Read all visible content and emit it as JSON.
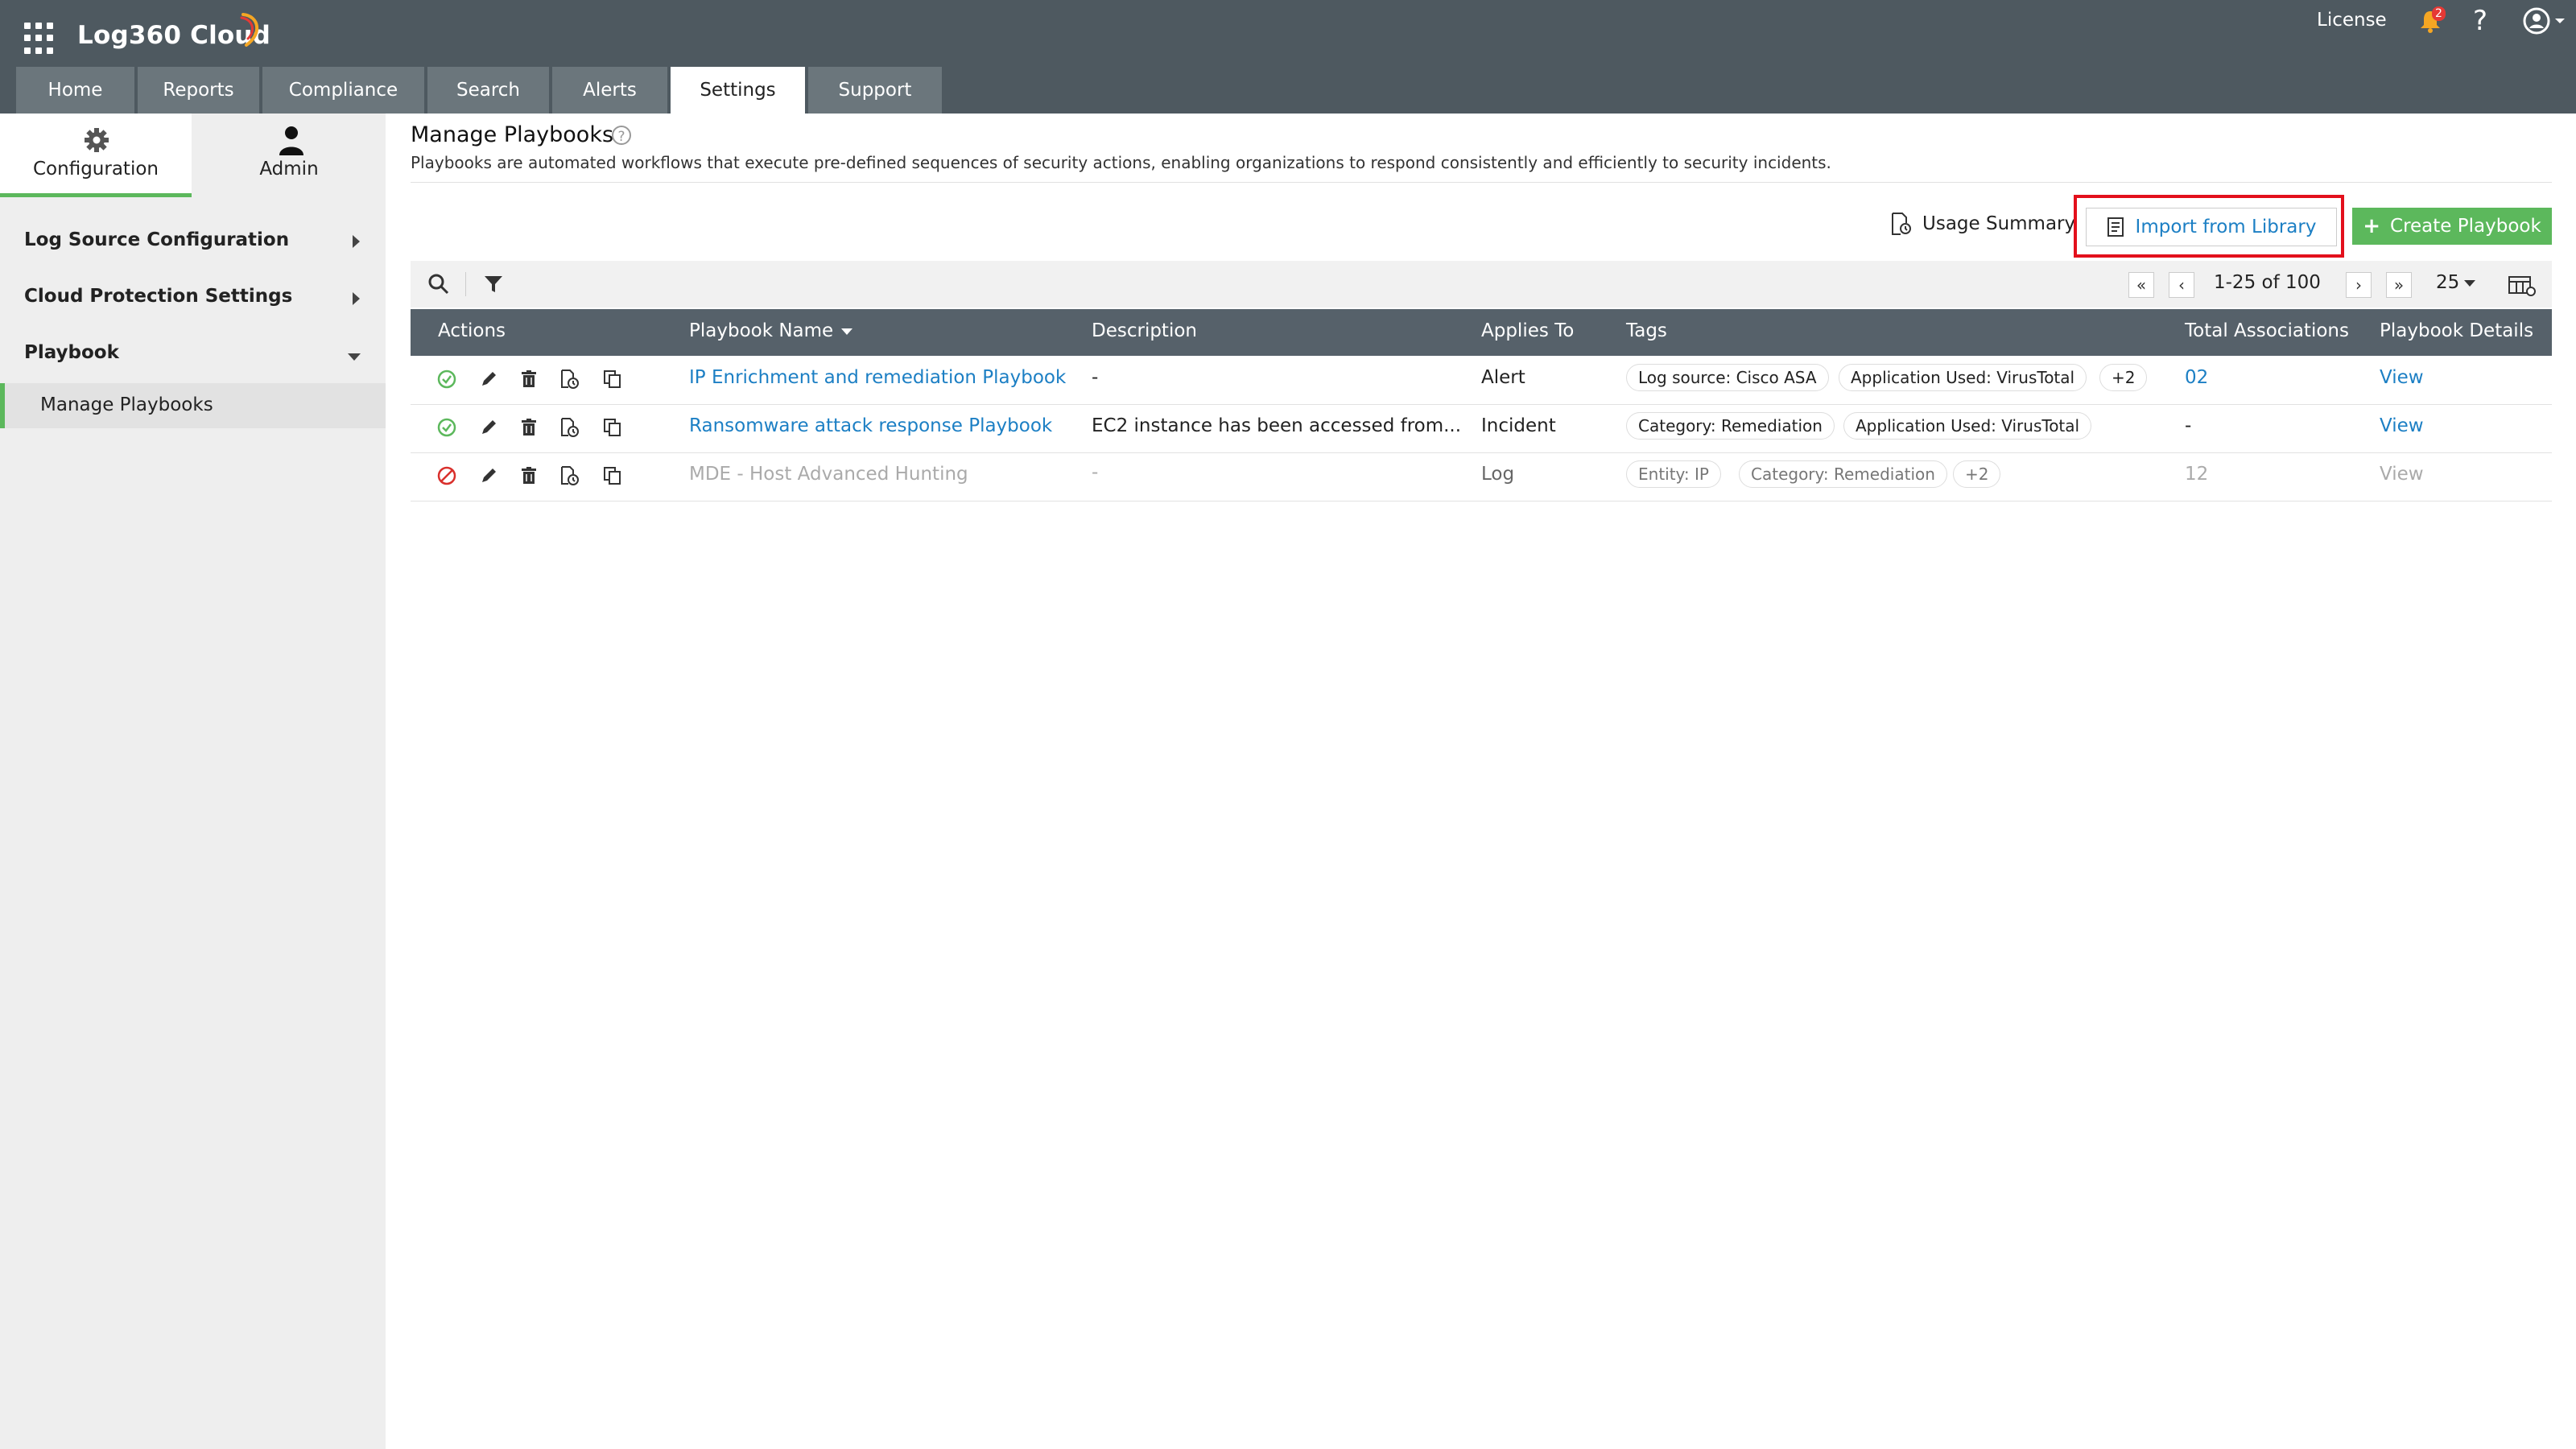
{
  "app": {
    "name": "Log360 Cloud",
    "license_label": "License",
    "notification_count": "2",
    "help_label": "?"
  },
  "nav_tabs": [
    {
      "label": "Home",
      "active": false
    },
    {
      "label": "Reports",
      "active": false
    },
    {
      "label": "Compliance",
      "active": false
    },
    {
      "label": "Search",
      "active": false
    },
    {
      "label": "Alerts",
      "active": false
    },
    {
      "label": "Settings",
      "active": true
    },
    {
      "label": "Support",
      "active": false
    }
  ],
  "sidebar": {
    "tabs": [
      {
        "label": "Configuration",
        "icon": "gear-icon",
        "active": true
      },
      {
        "label": "Admin",
        "icon": "user-icon",
        "active": false
      }
    ],
    "sections": [
      {
        "label": "Log Source Configuration",
        "expanded": false
      },
      {
        "label": "Cloud Protection Settings",
        "expanded": false
      },
      {
        "label": "Playbook",
        "expanded": true
      }
    ],
    "active_item": "Manage Playbooks"
  },
  "page": {
    "title": "Manage Playbooks",
    "description": "Playbooks are automated workflows that execute pre-defined sequences of security actions, enabling organizations to respond consistently and efficiently to security incidents."
  },
  "actions": {
    "usage_summary": "Usage Summary",
    "import_library": "Import from Library",
    "create_playbook": "Create Playbook"
  },
  "pagination": {
    "range": "1-25 of 100",
    "page_size": "25"
  },
  "table": {
    "columns": [
      "Actions",
      "Playbook Name",
      "Description",
      "Applies To",
      "Tags",
      "Total Associations",
      "Playbook Details"
    ],
    "rows": [
      {
        "status": "enabled",
        "name": "IP Enrichment and remediation Playbook",
        "description": "-",
        "applies_to": "Alert",
        "tags": [
          "Log source: Cisco ASA",
          "Application Used: VirusTotal",
          "+2"
        ],
        "associations": "02",
        "details": "View"
      },
      {
        "status": "enabled",
        "name": "Ransomware attack response Playbook",
        "description": "EC2 instance has been accessed from...",
        "applies_to": "Incident",
        "tags": [
          "Category: Remediation",
          "Application Used: VirusTotal"
        ],
        "associations": "-",
        "details": "View"
      },
      {
        "status": "disabled",
        "name": "MDE - Host Advanced Hunting",
        "description": "-",
        "applies_to": "Log",
        "tags": [
          "Entity: IP",
          "Category: Remediation",
          "+2"
        ],
        "associations": "12",
        "details": "View"
      }
    ]
  },
  "colors": {
    "header_bg": "#4e5960",
    "tab_bg": "#6b767c",
    "accent_green": "#5cb85c",
    "link_blue": "#1c7fc4",
    "highlight_red": "#e3101c",
    "table_header_bg": "#56616a"
  }
}
